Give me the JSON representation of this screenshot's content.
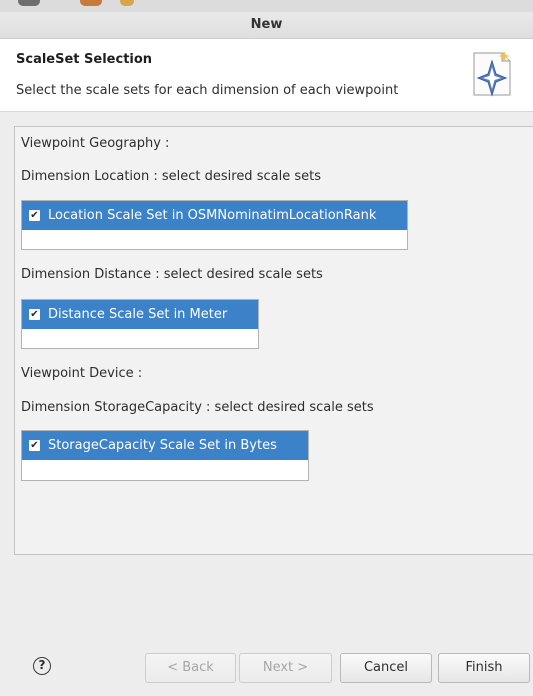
{
  "window": {
    "title": "New"
  },
  "header": {
    "title": "ScaleSet Selection",
    "description": "Select the scale sets for each dimension of each viewpoint"
  },
  "content": {
    "viewpoints": [
      {
        "label": "Viewpoint Geography :",
        "dimensions": [
          {
            "label": "Dimension Location : select desired scale sets",
            "items": [
              {
                "label": "Location Scale Set in OSMNominatimLocationRank",
                "checked": true
              }
            ]
          },
          {
            "label": "Dimension Distance : select desired scale sets",
            "items": [
              {
                "label": "Distance Scale Set in Meter",
                "checked": true
              }
            ]
          }
        ]
      },
      {
        "label": "Viewpoint Device :",
        "dimensions": [
          {
            "label": "Dimension StorageCapacity : select desired scale sets",
            "items": [
              {
                "label": "StorageCapacity Scale Set in Bytes",
                "checked": true
              }
            ]
          }
        ]
      }
    ]
  },
  "checkmark_glyph": "✔",
  "buttons": {
    "help": "?",
    "back": "< Back",
    "next": "Next >",
    "cancel": "Cancel",
    "finish": "Finish"
  },
  "colors": {
    "selection": "#3c82c8",
    "header_background": "#ffffff",
    "dialog_background": "#ededed"
  }
}
